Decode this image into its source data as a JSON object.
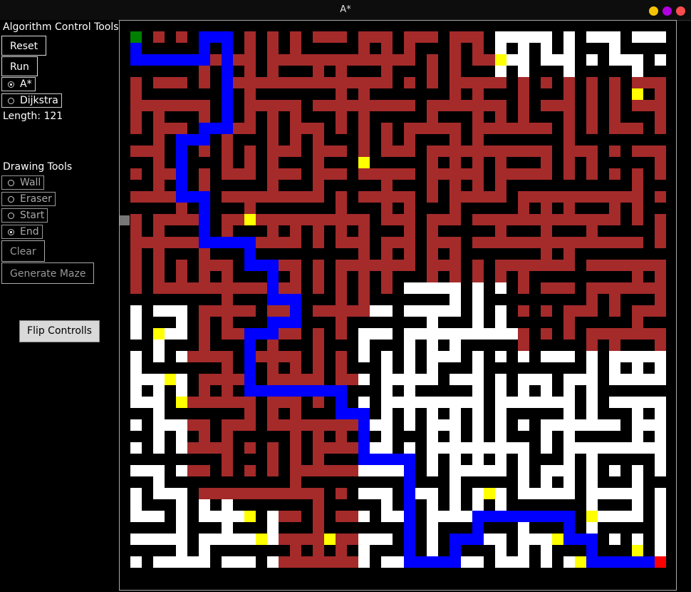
{
  "window": {
    "title": "A*",
    "controls": [
      {
        "name": "minimize",
        "color": "#f5c400"
      },
      {
        "name": "maximize",
        "color": "#b000e0"
      },
      {
        "name": "close",
        "color": "#ff4d4d"
      }
    ]
  },
  "algorithm_tools": {
    "heading": "Algorithm Control Tools:",
    "reset_label": "Reset",
    "run_label": "Run",
    "options": [
      {
        "label": "A*",
        "selected": true
      },
      {
        "label": "Dijkstra",
        "selected": false
      }
    ],
    "length_text": "Length: 121"
  },
  "drawing_tools": {
    "heading": "Drawing Tools",
    "options": [
      {
        "label": "Wall",
        "selected": false
      },
      {
        "label": "Eraser",
        "selected": false
      },
      {
        "label": "Start",
        "selected": false
      },
      {
        "label": "End",
        "selected": true
      }
    ],
    "clear_label": "Clear",
    "generate_label": "Generate Maze"
  },
  "flip_label": "Flip Controlls",
  "maze": {
    "size": 47,
    "colors": {
      "wall": "#000000",
      "explored": "#a52a2a",
      "open": "#ffffff",
      "frontier": "#ffff00",
      "path": "#0000ff",
      "start": "#008000",
      "end": "#ff0000"
    },
    "start_cell": [
      0,
      0
    ],
    "end_cell": [
      46,
      46
    ],
    "path_cells": [
      [
        0,
        0
      ],
      [
        0,
        1
      ],
      [
        0,
        2
      ],
      [
        1,
        2
      ],
      [
        2,
        2
      ],
      [
        3,
        2
      ],
      [
        4,
        2
      ],
      [
        5,
        2
      ],
      [
        6,
        2
      ],
      [
        6,
        1
      ],
      [
        6,
        0
      ],
      [
        7,
        0
      ],
      [
        8,
        0
      ],
      [
        8,
        1
      ],
      [
        8,
        2
      ],
      [
        8,
        3
      ],
      [
        8,
        4
      ],
      [
        8,
        5
      ],
      [
        8,
        6
      ],
      [
        8,
        7
      ],
      [
        8,
        8
      ],
      [
        7,
        8
      ],
      [
        6,
        8
      ],
      [
        6,
        9
      ],
      [
        5,
        9
      ],
      [
        4,
        9
      ],
      [
        4,
        10
      ],
      [
        4,
        11
      ],
      [
        4,
        12
      ],
      [
        4,
        13
      ],
      [
        4,
        14
      ],
      [
        5,
        14
      ],
      [
        6,
        14
      ],
      [
        6,
        15
      ],
      [
        6,
        16
      ],
      [
        6,
        17
      ],
      [
        6,
        18
      ],
      [
        7,
        18
      ],
      [
        8,
        18
      ],
      [
        9,
        18
      ],
      [
        10,
        18
      ],
      [
        10,
        19
      ],
      [
        10,
        20
      ],
      [
        11,
        20
      ],
      [
        12,
        20
      ],
      [
        12,
        21
      ],
      [
        12,
        22
      ],
      [
        12,
        23
      ],
      [
        13,
        23
      ],
      [
        14,
        23
      ],
      [
        14,
        24
      ],
      [
        14,
        25
      ],
      [
        13,
        25
      ],
      [
        12,
        25
      ],
      [
        12,
        26
      ],
      [
        11,
        26
      ],
      [
        10,
        26
      ],
      [
        10,
        27
      ],
      [
        10,
        28
      ],
      [
        10,
        29
      ],
      [
        10,
        30
      ],
      [
        10,
        31
      ],
      [
        11,
        31
      ],
      [
        12,
        31
      ],
      [
        13,
        31
      ],
      [
        14,
        31
      ],
      [
        15,
        31
      ],
      [
        16,
        31
      ],
      [
        17,
        31
      ],
      [
        18,
        31
      ],
      [
        18,
        32
      ],
      [
        18,
        33
      ],
      [
        19,
        33
      ],
      [
        20,
        33
      ],
      [
        20,
        34
      ],
      [
        20,
        35
      ],
      [
        20,
        36
      ],
      [
        20,
        37
      ],
      [
        21,
        37
      ],
      [
        22,
        37
      ],
      [
        23,
        37
      ],
      [
        24,
        37
      ],
      [
        24,
        38
      ],
      [
        24,
        39
      ],
      [
        24,
        40
      ],
      [
        24,
        41
      ],
      [
        24,
        42
      ],
      [
        24,
        43
      ],
      [
        24,
        44
      ],
      [
        24,
        45
      ],
      [
        24,
        46
      ],
      [
        25,
        46
      ],
      [
        26,
        46
      ],
      [
        27,
        46
      ],
      [
        28,
        46
      ],
      [
        28,
        45
      ],
      [
        28,
        44
      ],
      [
        29,
        44
      ],
      [
        30,
        44
      ],
      [
        30,
        43
      ],
      [
        30,
        42
      ],
      [
        31,
        42
      ],
      [
        32,
        42
      ],
      [
        33,
        42
      ],
      [
        34,
        42
      ],
      [
        35,
        42
      ],
      [
        36,
        42
      ],
      [
        37,
        42
      ],
      [
        38,
        42
      ],
      [
        38,
        43
      ],
      [
        38,
        44
      ],
      [
        39,
        44
      ],
      [
        40,
        44
      ],
      [
        40,
        45
      ],
      [
        40,
        46
      ],
      [
        41,
        46
      ],
      [
        42,
        46
      ],
      [
        43,
        46
      ],
      [
        44,
        46
      ],
      [
        45,
        46
      ],
      [
        46,
        46
      ]
    ],
    "frontier_cells": [
      [
        32,
        2
      ],
      [
        44,
        5
      ],
      [
        20,
        11
      ],
      [
        10,
        16
      ],
      [
        2,
        26
      ],
      [
        3,
        30
      ],
      [
        4,
        32
      ],
      [
        31,
        40
      ],
      [
        40,
        42
      ],
      [
        10,
        42
      ],
      [
        11,
        44
      ],
      [
        17,
        44
      ],
      [
        37,
        44
      ],
      [
        44,
        45
      ],
      [
        39,
        46
      ],
      [
        17,
        44
      ]
    ]
  }
}
